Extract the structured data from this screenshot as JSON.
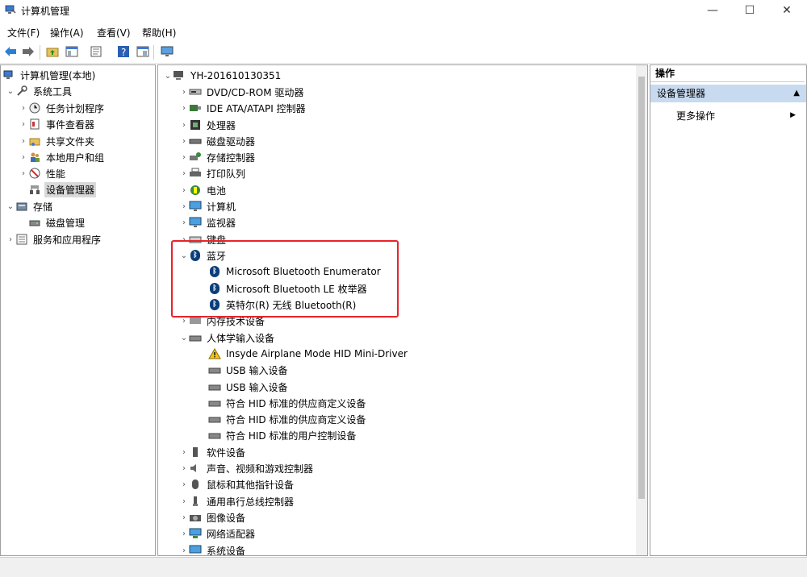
{
  "window": {
    "title": "计算机管理",
    "minimize": "—",
    "maximize": "☐",
    "close": "✕"
  },
  "menu": [
    "文件(F)",
    "操作(A)",
    "查看(V)",
    "帮助(H)"
  ],
  "left_tree": {
    "root": "计算机管理(本地)",
    "system_tools": "系统工具",
    "items": [
      "任务计划程序",
      "事件查看器",
      "共享文件夹",
      "本地用户和组",
      "性能",
      "设备管理器"
    ],
    "storage": "存储",
    "storage_items": [
      "磁盘管理"
    ],
    "services": "服务和应用程序"
  },
  "device_tree": {
    "computer": "YH-201610130351",
    "categories": [
      "DVD/CD-ROM 驱动器",
      "IDE ATA/ATAPI 控制器",
      "处理器",
      "磁盘驱动器",
      "存储控制器",
      "打印队列",
      "电池",
      "计算机",
      "监视器",
      "键盘"
    ],
    "bluetooth": "蓝牙",
    "bluetooth_items": [
      "Microsoft Bluetooth Enumerator",
      "Microsoft Bluetooth LE 枚举器",
      "英特尔(R) 无线 Bluetooth(R)"
    ],
    "memory": "内存技术设备",
    "hid": "人体学输入设备",
    "hid_items": [
      "Insyde Airplane Mode HID Mini-Driver",
      "USB 输入设备",
      "USB 输入设备",
      "符合 HID 标准的供应商定义设备",
      "符合 HID 标准的供应商定义设备",
      "符合 HID 标准的用户控制设备"
    ],
    "more_categories": [
      "软件设备",
      "声音、视频和游戏控制器",
      "鼠标和其他指针设备",
      "通用串行总线控制器",
      "图像设备",
      "网络适配器",
      "系统设备"
    ]
  },
  "actions": {
    "header": "操作",
    "section": "设备管理器",
    "more": "更多操作"
  },
  "colors": {
    "highlight": "#e8232a",
    "selection": "#d9d9d9",
    "action_bg": "#c8daf0"
  }
}
